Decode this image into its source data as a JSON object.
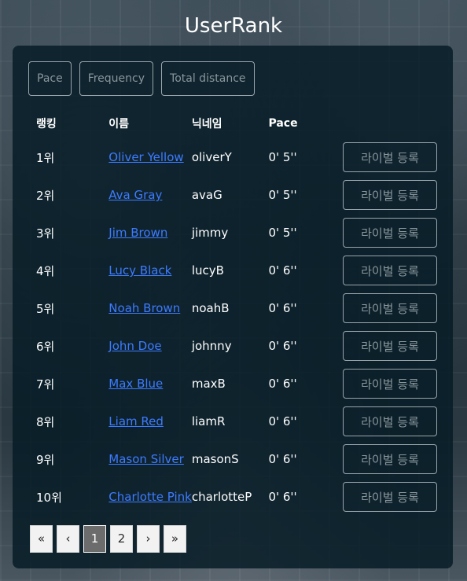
{
  "header": {
    "title": "UserRank"
  },
  "filters": [
    "Pace",
    "Frequency",
    "Total distance"
  ],
  "table": {
    "columns": [
      "랭킹",
      "이름",
      "닉네임",
      "Pace"
    ],
    "rows": [
      {
        "rank": "1위",
        "name": "Oliver Yellow",
        "nickname": "oliverY",
        "pace": "0' 5''",
        "action": "라이벌 등록"
      },
      {
        "rank": "2위",
        "name": "Ava Gray",
        "nickname": "avaG",
        "pace": "0' 5''",
        "action": "라이벌 등록"
      },
      {
        "rank": "3위",
        "name": "Jim Brown",
        "nickname": "jimmy",
        "pace": "0' 5''",
        "action": "라이벌 등록"
      },
      {
        "rank": "4위",
        "name": "Lucy Black",
        "nickname": "lucyB",
        "pace": "0' 6''",
        "action": "라이벌 등록"
      },
      {
        "rank": "5위",
        "name": "Noah Brown",
        "nickname": "noahB",
        "pace": "0' 6''",
        "action": "라이벌 등록"
      },
      {
        "rank": "6위",
        "name": "John Doe",
        "nickname": "johnny",
        "pace": "0' 6''",
        "action": "라이벌 등록"
      },
      {
        "rank": "7위",
        "name": "Max Blue",
        "nickname": "maxB",
        "pace": "0' 6''",
        "action": "라이벌 등록"
      },
      {
        "rank": "8위",
        "name": "Liam Red",
        "nickname": "liamR",
        "pace": "0' 6''",
        "action": "라이벌 등록"
      },
      {
        "rank": "9위",
        "name": "Mason Silver",
        "nickname": "masonS",
        "pace": "0' 6''",
        "action": "라이벌 등록"
      },
      {
        "rank": "10위",
        "name": "Charlotte Pink",
        "nickname": "charlotteP",
        "pace": "0' 6''",
        "action": "라이벌 등록"
      }
    ]
  },
  "pagination": {
    "first": "«",
    "prev": "‹",
    "pages": [
      "1",
      "2"
    ],
    "current": "1",
    "next": "›",
    "last": "»"
  },
  "colors": {
    "link": "#3d7bff",
    "panel": "#061c26",
    "button_text": "#8a969c",
    "active_page": "#6c6c6c"
  }
}
